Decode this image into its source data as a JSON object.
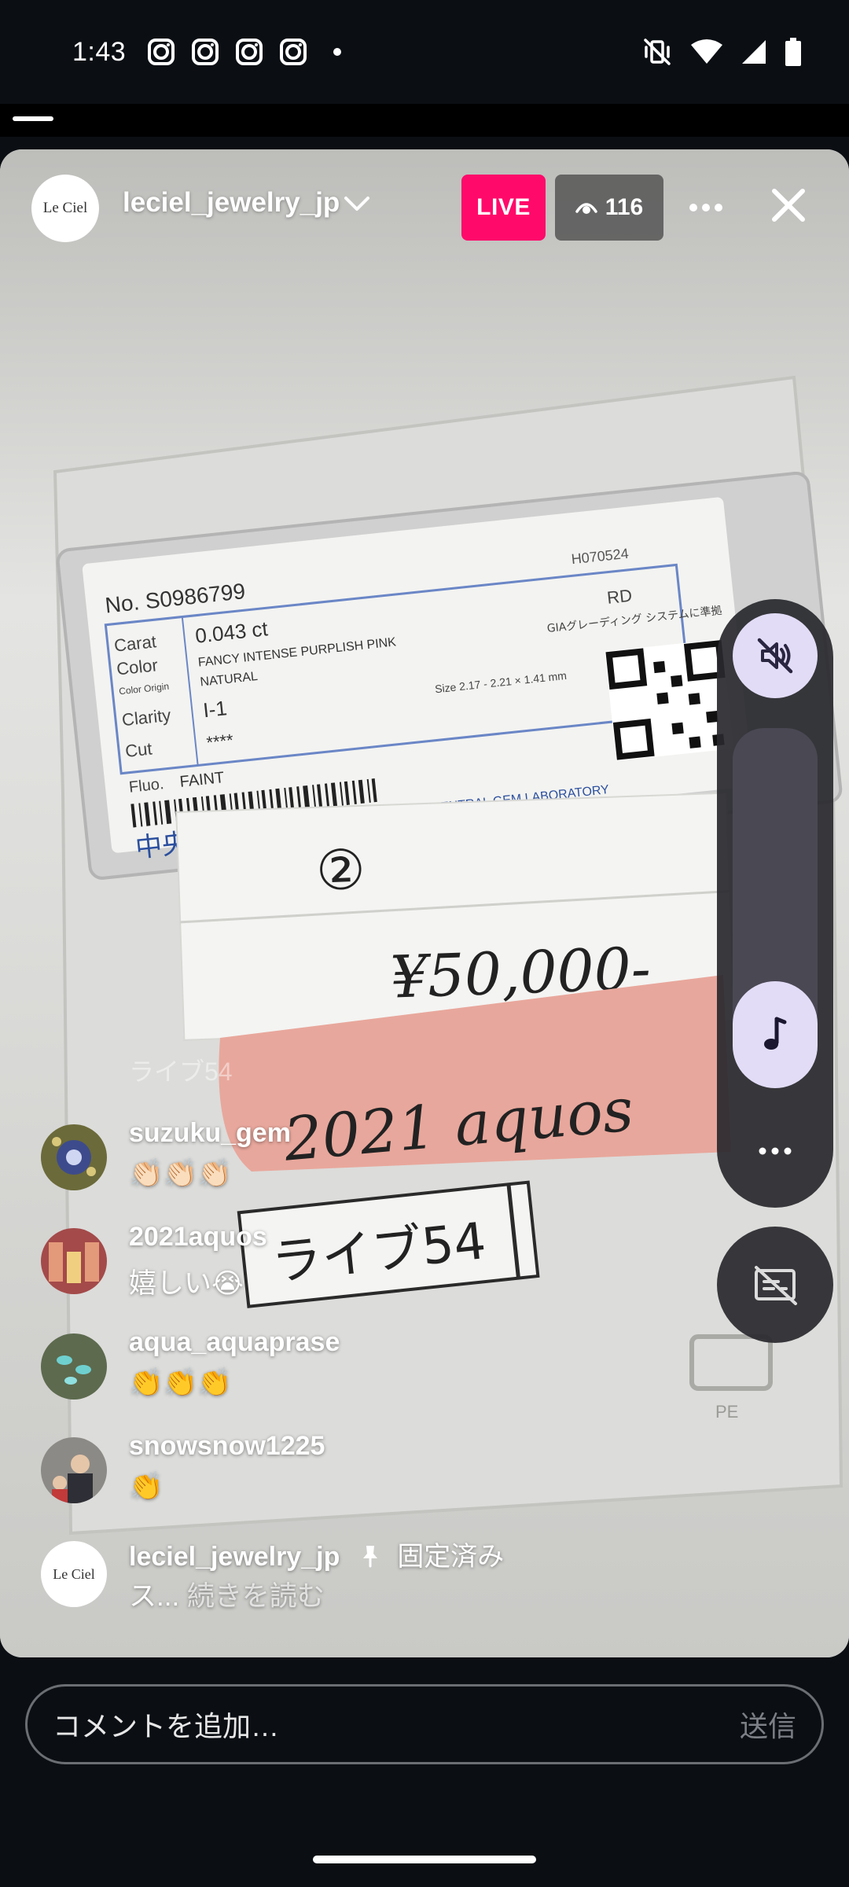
{
  "status_bar": {
    "time": "1:43"
  },
  "live": {
    "host_logo": "Le Ciel",
    "host_name": "leciel_jewelry_jp",
    "live_label": "LIVE",
    "viewer_count": "116",
    "progress_fraction": 0.05
  },
  "video": {
    "card_number": "No. S0986799",
    "card_code": "H070524",
    "card_fields": [
      {
        "label": "Carat",
        "value": "0.043 ct"
      },
      {
        "label": "Color",
        "value": "FANCY INTENSE PURPLISH PINK"
      },
      {
        "label": "Color Origin",
        "value": "NATURAL"
      },
      {
        "label": "Clarity",
        "value": "I-1"
      },
      {
        "label": "Cut",
        "value": "****"
      },
      {
        "label": "Fluo.",
        "value": "FAINT"
      }
    ],
    "card_shape": "RD",
    "card_note": "GIAグレーディング システムに準拠",
    "card_size": "Size 2.17 - 2.21 × 1.41 mm",
    "card_lab_jp": "中央宝石研究所",
    "card_lab_en": "CENTRAL GEM LABORATORY",
    "note_number": "②",
    "price": "¥50,000-",
    "buyer_note": "2021 aquos",
    "tag_label": "ライブ54",
    "bag_mark": "PE"
  },
  "comments": {
    "faded": "ライブ54",
    "items": [
      {
        "user": "suzuku_gem",
        "text": "👏🏻👏🏻👏🏻",
        "avatar_color": "#6b6a3a"
      },
      {
        "user": "2021aquos",
        "text": "嬉しい😭",
        "avatar_color": "#a44a4a"
      },
      {
        "user": "aqua_aquaprase",
        "text": "👏👏👏",
        "avatar_color": "#5d6a4e"
      },
      {
        "user": "snowsnow1225",
        "text": "👏",
        "avatar_color": "#8c8a86"
      }
    ],
    "pinned": {
      "user": "leciel_jewelry_jp",
      "avatar_logo": "Le Ciel",
      "pinned_label": "固定済み",
      "text": "ス...",
      "read_more": "続きを読む"
    }
  },
  "input": {
    "placeholder": "コメントを追加…",
    "send": "送信"
  },
  "icons": {
    "status_apps": [
      "instagram-icon",
      "instagram-icon",
      "instagram-icon",
      "instagram-icon"
    ],
    "status_right": [
      "vibrate-off-icon",
      "wifi-icon",
      "signal-icon",
      "battery-icon"
    ],
    "side": [
      "speaker-muted-icon",
      "music-note-icon",
      "more-horizontal-icon",
      "captions-off-icon"
    ]
  },
  "colors": {
    "live_badge": "#ff0a6a",
    "side_button": "#e3dcf7",
    "side_panel": "#28282e"
  }
}
